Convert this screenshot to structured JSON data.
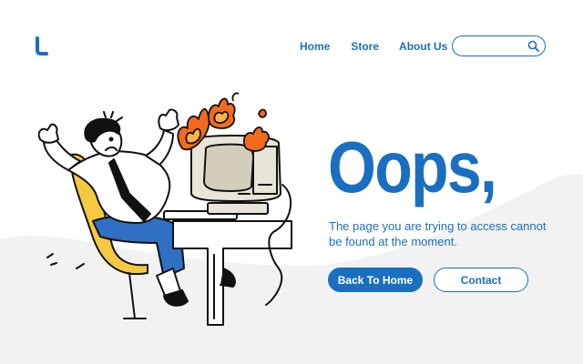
{
  "brand": {
    "logo_icon": "brand-logo-icon",
    "accent": "#1a6fc0"
  },
  "nav": {
    "items": [
      {
        "label": "Home"
      },
      {
        "label": "Store"
      },
      {
        "label": "About Us"
      }
    ]
  },
  "search": {
    "value": "",
    "placeholder": "",
    "icon": "search-icon"
  },
  "hero": {
    "headline": "Oops,",
    "message": "The page you are trying to access cannot be found at the moment.",
    "primary_button": "Back To Home",
    "secondary_button": "Contact"
  },
  "illustration": {
    "name": "frustrated-office-worker-with-burning-computer"
  },
  "colors": {
    "primary": "#1a6fc0",
    "background": "#ffffff",
    "wave": "#f2f2f2",
    "chair": "#f5c842",
    "fire": "#f26b1d",
    "pants": "#2f6fc4"
  }
}
